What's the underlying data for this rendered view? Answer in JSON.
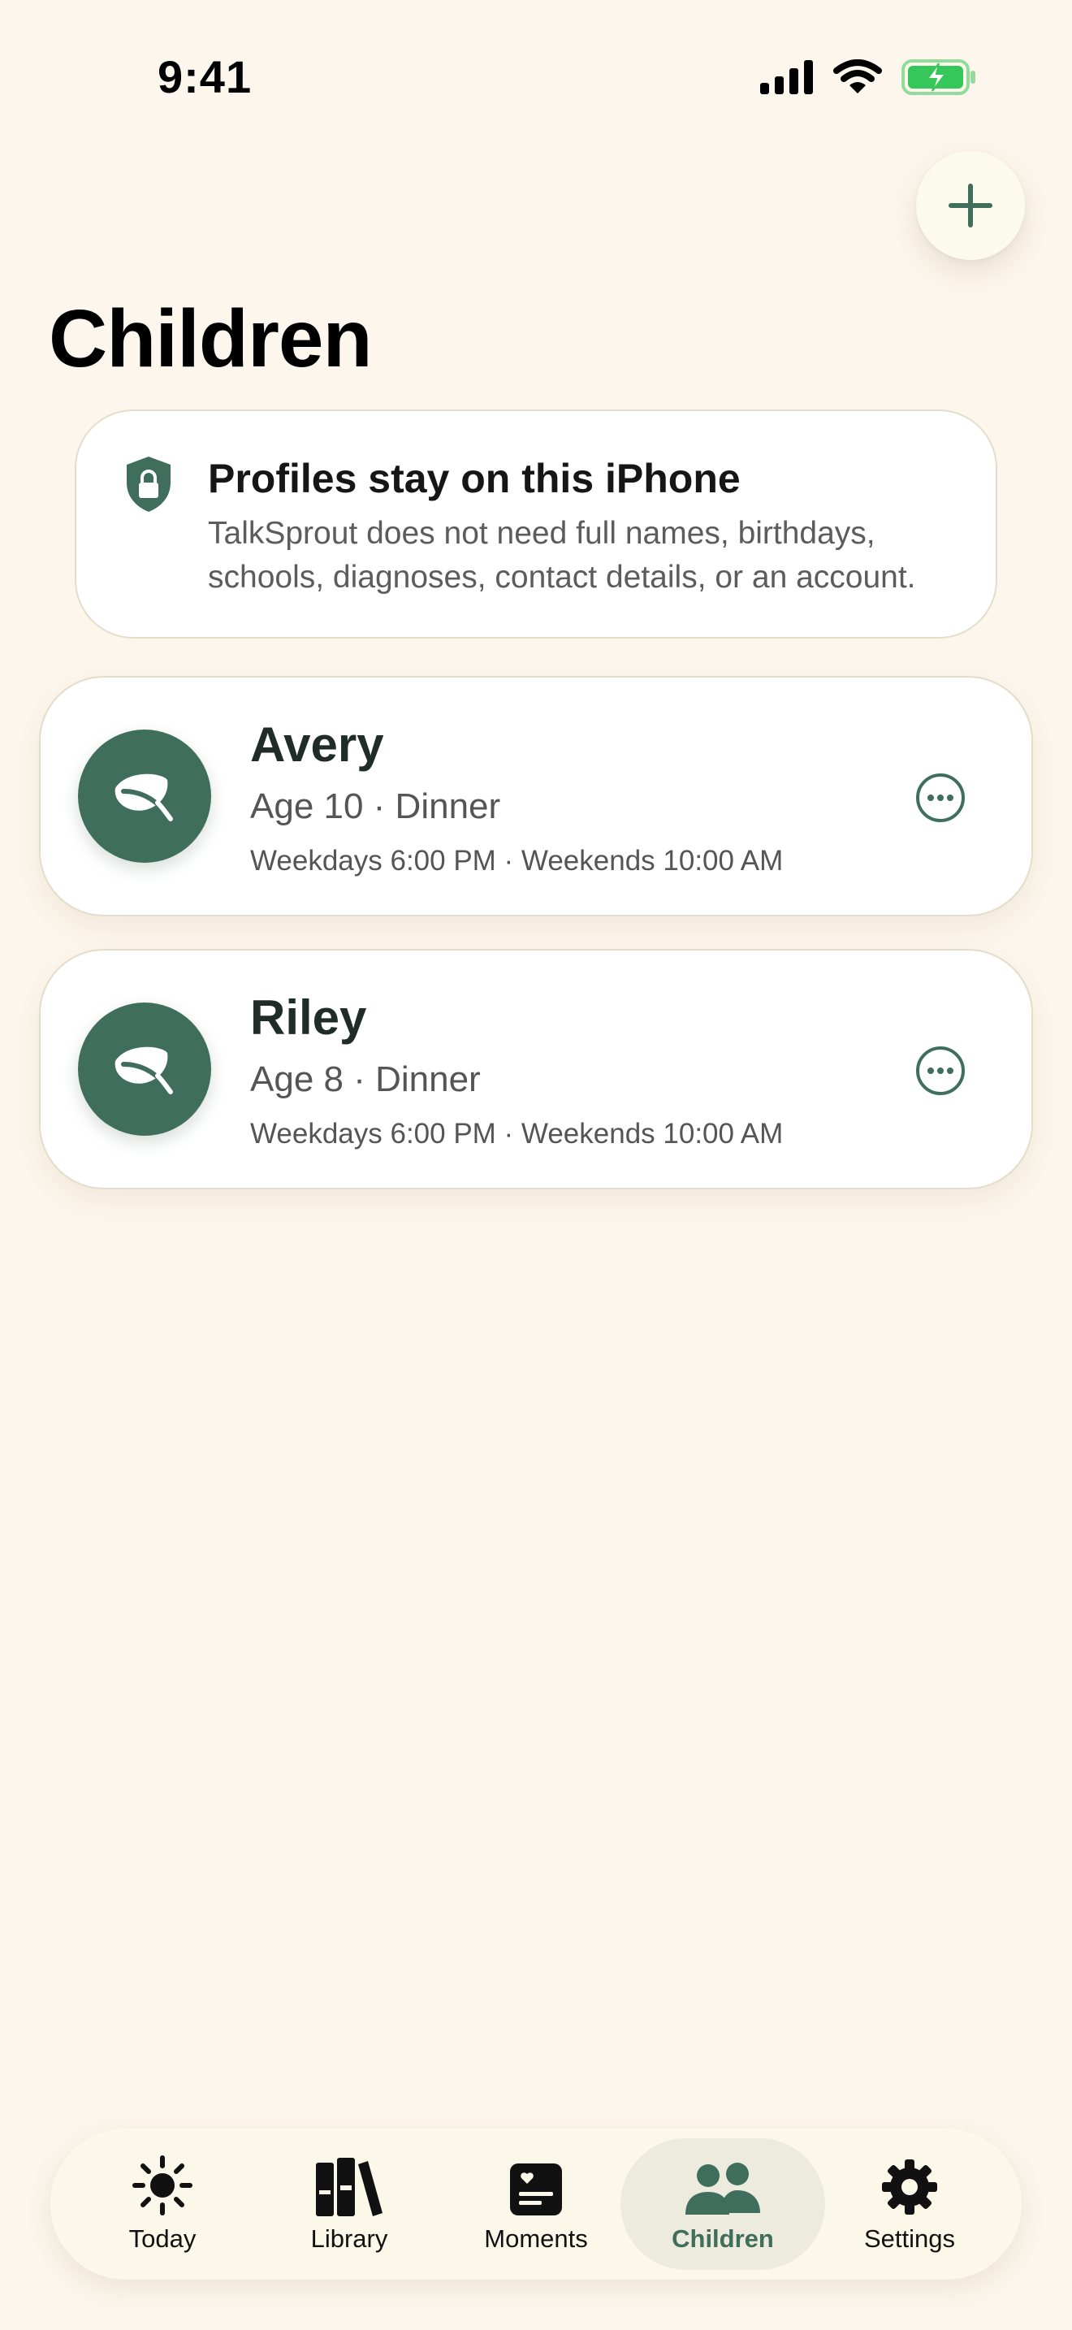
{
  "status_bar": {
    "time": "9:41"
  },
  "header": {
    "title": "Children",
    "add_icon": "plus-icon"
  },
  "privacy_notice": {
    "title": "Profiles stay on this iPhone",
    "body": "TalkSprout does not need full names, birthdays, schools, diagnoses, contact details, or an account.",
    "icon": "shield-lock-icon"
  },
  "children": [
    {
      "name": "Avery",
      "subtitle": "Age 10 · Dinner",
      "schedule": "Weekdays 6:00 PM · Weekends 10:00 AM",
      "avatar_icon": "leaf-icon"
    },
    {
      "name": "Riley",
      "subtitle": "Age 8 · Dinner",
      "schedule": "Weekdays 6:00 PM · Weekends 10:00 AM",
      "avatar_icon": "leaf-icon"
    }
  ],
  "tab_bar": {
    "active": "Children",
    "items": [
      {
        "label": "Today",
        "icon": "sun-icon"
      },
      {
        "label": "Library",
        "icon": "books-icon"
      },
      {
        "label": "Moments",
        "icon": "moments-icon"
      },
      {
        "label": "Children",
        "icon": "people-icon"
      },
      {
        "label": "Settings",
        "icon": "gear-icon"
      }
    ]
  },
  "colors": {
    "background": "#FDF6EC",
    "accent": "#3F6E5C",
    "card": "#FFFFFF",
    "tab_bar": "#FBF8E9",
    "battery": "#35C759"
  }
}
